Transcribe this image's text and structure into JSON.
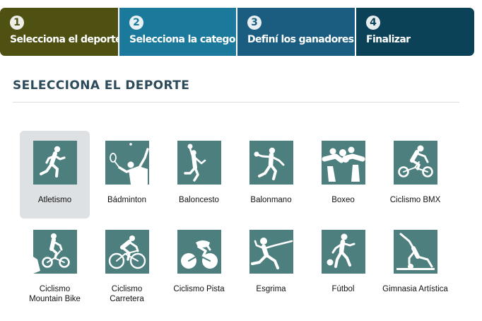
{
  "steps": [
    {
      "num": "1",
      "label": "Selecciona el deporte"
    },
    {
      "num": "2",
      "label": "Selecciona la categoría"
    },
    {
      "num": "3",
      "label": "Definí los ganadores"
    },
    {
      "num": "4",
      "label": "Finalizar"
    }
  ],
  "section": {
    "title": "SELECCIONA EL DEPORTE"
  },
  "sports": [
    {
      "name": "Atletismo",
      "icon": "athletics-icon"
    },
    {
      "name": "Bádminton",
      "icon": "badminton-icon"
    },
    {
      "name": "Baloncesto",
      "icon": "basketball-icon"
    },
    {
      "name": "Balonmano",
      "icon": "handball-icon"
    },
    {
      "name": "Boxeo",
      "icon": "boxing-icon"
    },
    {
      "name": "Ciclismo BMX",
      "icon": "bmx-icon"
    },
    {
      "name": "Ciclismo\nMountain Bike",
      "icon": "mountain-bike-icon"
    },
    {
      "name": "Ciclismo\nCarretera",
      "icon": "road-cycling-icon"
    },
    {
      "name": "Ciclismo Pista",
      "icon": "track-cycling-icon"
    },
    {
      "name": "Esgrima",
      "icon": "fencing-icon"
    },
    {
      "name": "Fútbol",
      "icon": "football-icon"
    },
    {
      "name": "Gimnasia Artística",
      "icon": "artistic-gymnastics-icon"
    }
  ],
  "colors": {
    "step1": "#4e5112",
    "step2": "#1b7a9b",
    "step3": "#1b5d80",
    "step4": "#0b4257",
    "icon_bg": "#4e7f7f",
    "selected_bg": "#dde1e3"
  }
}
